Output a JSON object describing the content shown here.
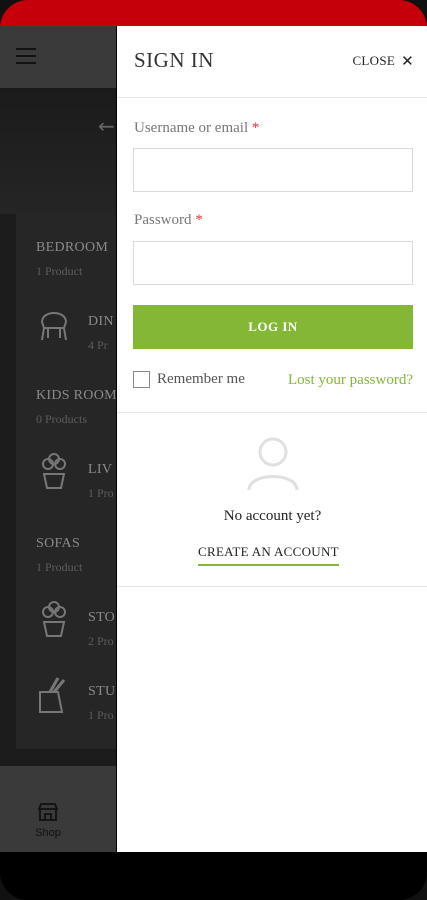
{
  "theme": {
    "accent": "#83b735",
    "status_bar": "#c5000a",
    "required": "#e0333c"
  },
  "background": {
    "categories": [
      {
        "title": "BEDROOM",
        "count": "1 Product",
        "icon": ""
      },
      {
        "title": "DIN",
        "count": "4 Pr",
        "icon": "chair-icon"
      },
      {
        "title": "KIDS ROOM",
        "count": "0 Products",
        "icon": ""
      },
      {
        "title": "LIV",
        "count": "1 Pro",
        "icon": "plant-pot-icon"
      },
      {
        "title": "SOFAS",
        "count": "1 Product",
        "icon": ""
      },
      {
        "title": "STO",
        "count": "2 Pro",
        "icon": "plant-pot-icon"
      },
      {
        "title": "STU",
        "count": "1 Pro",
        "icon": "knife-block-icon"
      }
    ],
    "bottom_nav": {
      "shop_label": "Shop"
    }
  },
  "drawer": {
    "title": "SIGN IN",
    "close_label": "CLOSE",
    "username_label": "Username or email",
    "password_label": "Password",
    "required_mark": "*",
    "username_value": "",
    "password_value": "",
    "login_label": "LOG IN",
    "remember_label": "Remember me",
    "lost_password_label": "Lost your password?",
    "no_account_text": "No account yet?",
    "create_account_label": "CREATE AN ACCOUNT"
  }
}
